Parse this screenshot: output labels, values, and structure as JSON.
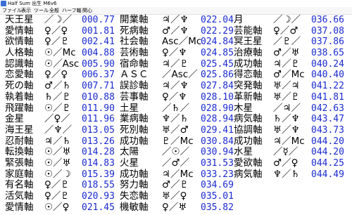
{
  "window": {
    "title": "Half Sum  出生  M6v6"
  },
  "menu": [
    "ファイル",
    "表示",
    "ツール",
    "全般",
    "ハーフ軸",
    "関心"
  ],
  "columns": [
    [
      {
        "name": "天王星",
        "formula": "／☽／",
        "value": "000.77"
      },
      {
        "name": "愛情軸",
        "formula": "♀／♀",
        "value": "001.81"
      },
      {
        "name": "欲情軸",
        "formula": "♀／♇",
        "value": "002.41"
      },
      {
        "name": "人格軸",
        "formula": "☉／Mc",
        "value": "004.88"
      },
      {
        "name": "認識軸",
        "formula": "☉／Asc",
        "value": "005.90"
      },
      {
        "name": "恋愛軸",
        "formula": "♀／♀",
        "value": "006.37"
      },
      {
        "name": "死の軸",
        "formula": "♂／♄",
        "value": "007.71"
      },
      {
        "name": "執着軸",
        "formula": "♄／♇",
        "value": "010.88"
      },
      {
        "name": "飛躍軸",
        "formula": "☉／♇",
        "value": "011.90"
      },
      {
        "name": "金星",
        "formula": "／♀／",
        "value": "011.96"
      },
      {
        "name": "海王星",
        "formula": "／♆／",
        "value": "013.05"
      },
      {
        "name": "忍耐軸",
        "formula": "♃／♄",
        "value": "013.26"
      },
      {
        "name": "転換軸",
        "formula": "☉／♅",
        "value": "014.28"
      },
      {
        "name": "緊張軸",
        "formula": "☉／♅",
        "value": "014.83"
      },
      {
        "name": "家庭軸",
        "formula": "☉／☽",
        "value": "015.39"
      },
      {
        "name": "有名軸",
        "formula": "♀／♇",
        "value": "018.55"
      },
      {
        "name": "活気軸",
        "formula": "♀／♇",
        "value": "020.93"
      },
      {
        "name": "愛情軸",
        "formula": "☉／♀",
        "value": "021.45"
      }
    ],
    [
      {
        "name": "開業軸",
        "formula": "♃／♆",
        "value": "022.04"
      },
      {
        "name": "死病軸",
        "formula": "♂／♆",
        "value": "022.29"
      },
      {
        "name": "社会軸",
        "formula": "Asc／Mc",
        "value": "024.84"
      },
      {
        "name": "芸術軸",
        "formula": "♀／♆",
        "value": "024.85"
      },
      {
        "name": "宿命軸",
        "formula": "♃／♇",
        "value": "025.45"
      },
      {
        "name": "ＡＳＣ",
        "formula": "／Asc／",
        "value": "025.86"
      },
      {
        "name": "誤診軸",
        "formula": "♃／♆",
        "value": "027.84"
      },
      {
        "name": "芸事軸",
        "formula": "♀／♆",
        "value": "028.10"
      },
      {
        "name": "土星",
        "formula": "／♄／",
        "value": "028.90"
      },
      {
        "name": "業病軸",
        "formula": "♆／♄",
        "value": "028.94"
      },
      {
        "name": "死別軸",
        "formula": "♅／♂",
        "value": "029.41"
      },
      {
        "name": "成功軸",
        "formula": "♇／Mc",
        "value": "030.84"
      },
      {
        "name": "太陽",
        "formula": "／☉／",
        "value": "030.94"
      },
      {
        "name": "火星",
        "formula": "／♂／",
        "value": "031.53"
      },
      {
        "name": "成功軸",
        "formula": "♃／Mc",
        "value": "033.23"
      },
      {
        "name": "努力軸",
        "formula": "♂／♇",
        "value": "034.69"
      },
      {
        "name": "失恋軸",
        "formula": "♅／♀",
        "value": "035.01"
      },
      {
        "name": "機敏軸",
        "formula": "♀／♅",
        "value": "035.82"
      }
    ],
    [
      {
        "name": "月",
        "formula": "／☽／",
        "value": "036.66"
      },
      {
        "name": "芸能軸",
        "formula": "♀／♂",
        "value": "037.08"
      },
      {
        "name": "冥王星",
        "formula": "／♇／",
        "value": "037.86"
      },
      {
        "name": "治療軸",
        "formula": "♂／♅",
        "value": "038.65"
      },
      {
        "name": "成功軸",
        "formula": "♃／♇",
        "value": "040.24"
      },
      {
        "name": "得恋軸",
        "formula": "♂／Mc",
        "value": "040.40"
      },
      {
        "name": "突発軸",
        "formula": "♅／♃",
        "value": "041.22"
      },
      {
        "name": "革新軸",
        "formula": "♅／♇",
        "value": "041.81"
      },
      {
        "name": "木星",
        "formula": "／♃／",
        "value": "042.63"
      },
      {
        "name": "病気軸",
        "formula": "♄／♆",
        "value": "043.47"
      },
      {
        "name": "協調軸",
        "formula": "♅／♆",
        "value": "043.73"
      },
      {
        "name": "成功軸",
        "formula": "♃／Mc",
        "value": "044.20"
      },
      {
        "name": "水星",
        "formula": "／☿／",
        "value": "044.20"
      },
      {
        "name": "愛欲軸",
        "formula": "♂／♀",
        "value": "044.25"
      },
      {
        "name": "病気軸",
        "formula": "♆／♄",
        "value": "044.49"
      }
    ]
  ]
}
